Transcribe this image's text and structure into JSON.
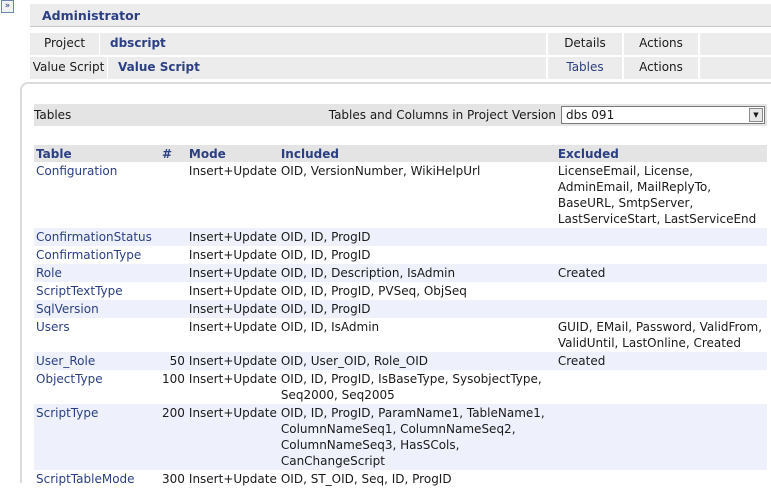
{
  "admin": {
    "title": "Administrator"
  },
  "project_row": {
    "label": "Project",
    "value": "dbscript",
    "details": "Details",
    "actions": "Actions"
  },
  "script_row": {
    "label": "Value Script",
    "value": "Value Script",
    "tables": "Tables",
    "actions": "Actions"
  },
  "tables_header": {
    "title": "Tables",
    "caption": "Tables and Columns in Project Version",
    "selected_version": "dbs 091"
  },
  "columns": {
    "table": "Table",
    "num": "#",
    "mode": "Mode",
    "included": "Included",
    "excluded": "Excluded"
  },
  "rows": [
    {
      "table": "Configuration",
      "num": "",
      "mode": "Insert+Update",
      "included": "OID, VersionNumber, WikiHelpUrl",
      "excluded": "LicenseEmail, License, AdminEmail, MailReplyTo, BaseURL, SmtpServer, LastServiceStart, LastServiceEnd"
    },
    {
      "table": "ConfirmationStatus",
      "num": "",
      "mode": "Insert+Update",
      "included": "OID, ID, ProgID",
      "excluded": ""
    },
    {
      "table": "ConfirmationType",
      "num": "",
      "mode": "Insert+Update",
      "included": "OID, ID, ProgID",
      "excluded": ""
    },
    {
      "table": "Role",
      "num": "",
      "mode": "Insert+Update",
      "included": "OID, ID, Description, IsAdmin",
      "excluded": "Created"
    },
    {
      "table": "ScriptTextType",
      "num": "",
      "mode": "Insert+Update",
      "included": "OID, ID, ProgID, PVSeq, ObjSeq",
      "excluded": ""
    },
    {
      "table": "SqlVersion",
      "num": "",
      "mode": "Insert+Update",
      "included": "OID, ID, ProgID",
      "excluded": ""
    },
    {
      "table": "Users",
      "num": "",
      "mode": "Insert+Update",
      "included": "OID, ID, IsAdmin",
      "excluded": "GUID, EMail, Password, ValidFrom, ValidUntil, LastOnline, Created"
    },
    {
      "table": "User_Role",
      "num": "50",
      "mode": "Insert+Update",
      "included": "OID, User_OID, Role_OID",
      "excluded": "Created"
    },
    {
      "table": "ObjectType",
      "num": "100",
      "mode": "Insert+Update",
      "included": "OID, ID, ProgID, IsBaseType, SysobjectType, Seq2000, Seq2005",
      "excluded": ""
    },
    {
      "table": "ScriptType",
      "num": "200",
      "mode": "Insert+Update",
      "included": "OID, ID, ProgID, ParamName1, TableName1, ColumnNameSeq1, ColumnNameSeq2, ColumnNameSeq3, HasSCols, CanChangeScript",
      "excluded": ""
    },
    {
      "table": "ScriptTableMode",
      "num": "300",
      "mode": "Insert+Update",
      "included": "OID, ST_OID, Seq, ID, ProgID",
      "excluded": ""
    }
  ]
}
